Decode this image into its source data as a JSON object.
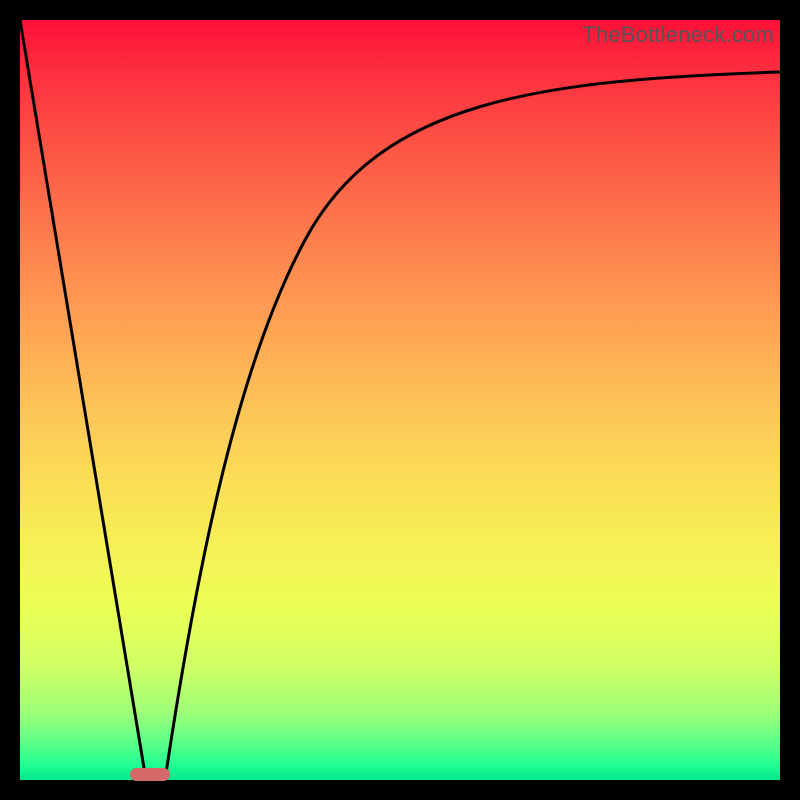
{
  "watermark": "TheBottleneck.com",
  "chart_data": {
    "type": "line",
    "title": "",
    "xlabel": "",
    "ylabel": "",
    "xlim": [
      0,
      100
    ],
    "ylim": [
      0,
      100
    ],
    "grid": false,
    "legend": false,
    "background_gradient": {
      "direction": "vertical",
      "stops": [
        {
          "pos": 0,
          "color": "#fd1037"
        },
        {
          "pos": 50,
          "color": "#fdc157"
        },
        {
          "pos": 78,
          "color": "#eaff57"
        },
        {
          "pos": 100,
          "color": "#00e88e"
        }
      ]
    },
    "series": [
      {
        "name": "left-line",
        "x": [
          0,
          16.5
        ],
        "y": [
          100,
          0
        ]
      },
      {
        "name": "right-curve",
        "x": [
          19,
          22,
          26,
          31,
          37,
          44,
          52,
          61,
          72,
          85,
          100
        ],
        "y": [
          0,
          18,
          36,
          51,
          63,
          72,
          79,
          84,
          88,
          91,
          93
        ]
      }
    ],
    "marker": {
      "name": "optimum-marker",
      "x_range": [
        14.5,
        19.5
      ],
      "y": 0,
      "color": "#d66a6a"
    }
  }
}
